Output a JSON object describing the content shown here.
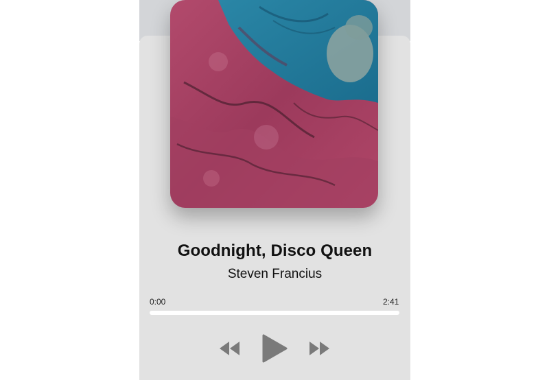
{
  "track": {
    "title": "Goodnight, Disco Queen",
    "artist": "Steven Francius"
  },
  "player": {
    "elapsed": "0:00",
    "duration": "2:41",
    "progress_fraction": 0.0
  },
  "controls": {
    "rewind_icon": "rewind-icon",
    "play_icon": "play-icon",
    "forward_icon": "fast-forward-icon"
  },
  "colors": {
    "card_background": "#e2e2e2",
    "top_band": "#d3d5d8",
    "control_gray": "#7a7a7a",
    "progress_track": "#ffffff"
  }
}
